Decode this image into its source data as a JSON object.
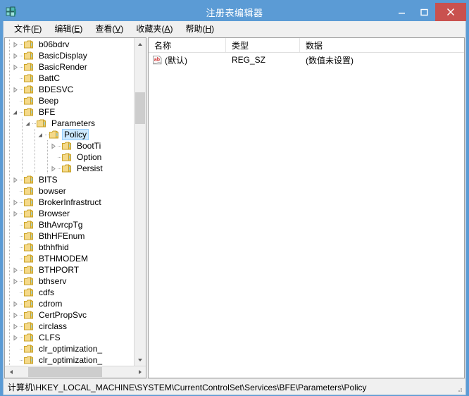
{
  "window": {
    "title": "注册表编辑器",
    "app_icon": "regedit-icon",
    "minimize_label": "最小化",
    "maximize_label": "最大化",
    "close_label": "关闭",
    "accent_title_bg": "#5b9bd5",
    "close_button_bg": "#c9514f"
  },
  "menubar": {
    "items": [
      {
        "label": "文件",
        "accel": "F"
      },
      {
        "label": "编辑",
        "accel": "E"
      },
      {
        "label": "查看",
        "accel": "V"
      },
      {
        "label": "收藏夹",
        "accel": "A"
      },
      {
        "label": "帮助",
        "accel": "H"
      }
    ]
  },
  "tree": {
    "selected_key": "Policy",
    "selection_bg": "#cce8ff",
    "selection_border": "#99d1ff",
    "nodes": [
      {
        "label": "b06bdrv",
        "depth": 2,
        "expander": "collapsed"
      },
      {
        "label": "BasicDisplay",
        "depth": 2,
        "expander": "collapsed"
      },
      {
        "label": "BasicRender",
        "depth": 2,
        "expander": "collapsed"
      },
      {
        "label": "BattC",
        "depth": 2,
        "expander": "none"
      },
      {
        "label": "BDESVC",
        "depth": 2,
        "expander": "collapsed"
      },
      {
        "label": "Beep",
        "depth": 2,
        "expander": "none"
      },
      {
        "label": "BFE",
        "depth": 2,
        "expander": "expanded"
      },
      {
        "label": "Parameters",
        "depth": 3,
        "expander": "expanded"
      },
      {
        "label": "Policy",
        "depth": 4,
        "expander": "expanded",
        "selected": true
      },
      {
        "label": "BootTi",
        "depth": 5,
        "expander": "collapsed"
      },
      {
        "label": "Option",
        "depth": 5,
        "expander": "none"
      },
      {
        "label": "Persist",
        "depth": 5,
        "expander": "collapsed"
      },
      {
        "label": "BITS",
        "depth": 2,
        "expander": "collapsed"
      },
      {
        "label": "bowser",
        "depth": 2,
        "expander": "none"
      },
      {
        "label": "BrokerInfrastruct",
        "depth": 2,
        "expander": "collapsed"
      },
      {
        "label": "Browser",
        "depth": 2,
        "expander": "collapsed"
      },
      {
        "label": "BthAvrcpTg",
        "depth": 2,
        "expander": "none"
      },
      {
        "label": "BthHFEnum",
        "depth": 2,
        "expander": "none"
      },
      {
        "label": "bthhfhid",
        "depth": 2,
        "expander": "none"
      },
      {
        "label": "BTHMODEM",
        "depth": 2,
        "expander": "none"
      },
      {
        "label": "BTHPORT",
        "depth": 2,
        "expander": "collapsed"
      },
      {
        "label": "bthserv",
        "depth": 2,
        "expander": "collapsed"
      },
      {
        "label": "cdfs",
        "depth": 2,
        "expander": "none"
      },
      {
        "label": "cdrom",
        "depth": 2,
        "expander": "collapsed"
      },
      {
        "label": "CertPropSvc",
        "depth": 2,
        "expander": "collapsed"
      },
      {
        "label": "circlass",
        "depth": 2,
        "expander": "collapsed"
      },
      {
        "label": "CLFS",
        "depth": 2,
        "expander": "collapsed"
      },
      {
        "label": "clr_optimization_",
        "depth": 2,
        "expander": "none"
      },
      {
        "label": "clr_optimization_",
        "depth": 2,
        "expander": "none"
      }
    ]
  },
  "list": {
    "columns": [
      "名称",
      "类型",
      "数据"
    ],
    "rows": [
      {
        "name": "(默认)",
        "type": "REG_SZ",
        "data": "(数值未设置)",
        "icon": "string-value-icon"
      }
    ]
  },
  "statusbar": {
    "path": "计算机\\HKEY_LOCAL_MACHINE\\SYSTEM\\CurrentControlSet\\Services\\BFE\\Parameters\\Policy"
  }
}
